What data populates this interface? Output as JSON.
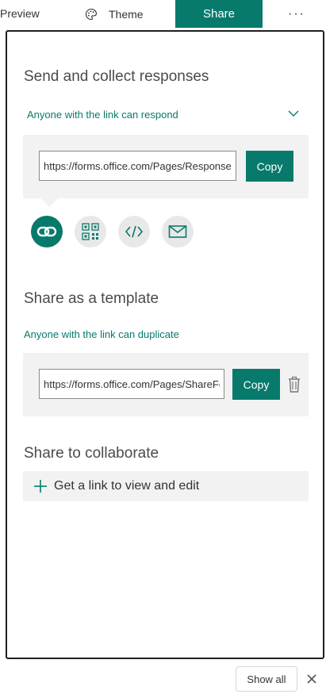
{
  "toolbar": {
    "preview_label": "Preview",
    "theme_label": "Theme",
    "share_label": "Share",
    "more_label": "···",
    "accent": "#077a6c"
  },
  "send_section": {
    "title": "Send and collect responses",
    "permission": "Anyone with the link can respond",
    "url": "https://forms.office.com/Pages/ResponsePage.aspx",
    "copy_label": "Copy",
    "share_methods": [
      {
        "icon": "link-icon",
        "active": true
      },
      {
        "icon": "qr-code-icon",
        "active": false
      },
      {
        "icon": "embed-code-icon",
        "active": false
      },
      {
        "icon": "email-icon",
        "active": false
      }
    ]
  },
  "template_section": {
    "title": "Share as a template",
    "permission": "Anyone with the link can duplicate",
    "url": "https://forms.office.com/Pages/ShareFormPage.aspx",
    "copy_label": "Copy"
  },
  "collaborate_section": {
    "title": "Share to collaborate",
    "link_label": "Get a link to view and edit"
  },
  "bottom_bar": {
    "show_all_label": "Show all"
  }
}
